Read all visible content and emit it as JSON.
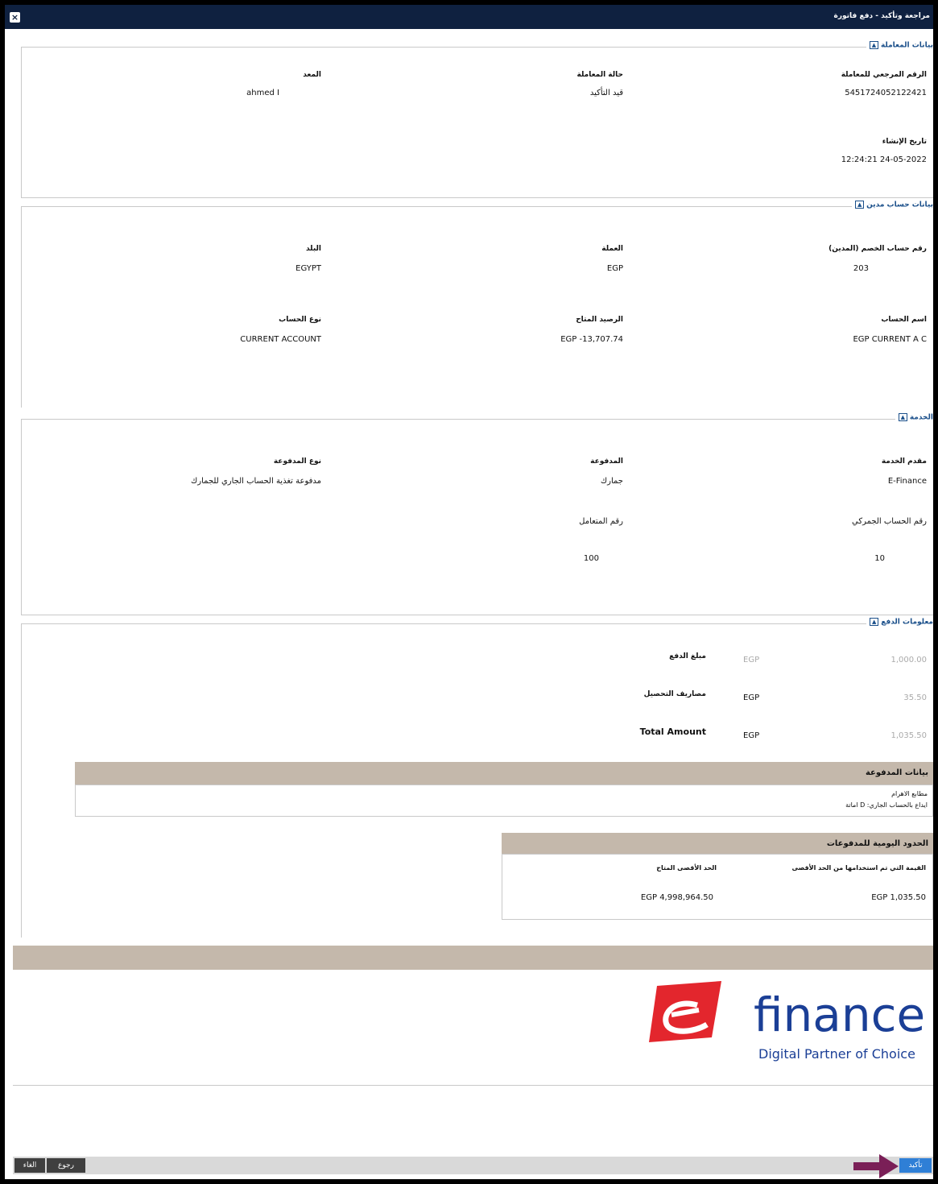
{
  "window": {
    "title": "مراجعة وتأكيد - دفع فاتورة"
  },
  "transaction": {
    "legend": "بيانات المعاملة",
    "ref_label": "الرقم المرجعي للمعاملة",
    "ref_value": "5451724052122421",
    "status_label": "حالة المعاملة",
    "status_value": "قيد التأكيد",
    "user_label": "المعد",
    "user_value": "ahmed I",
    "created_label": "تاريخ الإنشاء",
    "created_value": "12:24:21 24-05-2022"
  },
  "debit_account": {
    "legend": "بيانات حساب مدين",
    "account_no_label": "رقم حساب الخصم (المدين)",
    "account_no_value": "203",
    "currency_label": "العملة",
    "currency_value": "EGP",
    "country_label": "البلد",
    "country_value": "EGYPT",
    "account_name_label": "اسم الحساب",
    "account_name_value": "EGP CURRENT A C",
    "balance_label": "الرصيد المتاح",
    "balance_value": "EGP -13,707.74",
    "account_type_label": "نوع الحساب",
    "account_type_value": "CURRENT ACCOUNT"
  },
  "service": {
    "legend": "الخدمة",
    "provider_label": "مقدم الخدمة",
    "provider_value": "E-Finance",
    "payment_label": "المدفوعة",
    "payment_value": "جمارك",
    "payment_type_label": "نوع المدفوعة",
    "payment_type_value": "مدفوعة تغذية الحساب الجاري للجمارك",
    "customs_acc_label": "رقم الحساب الجمركي",
    "customs_acc_value": "10",
    "dealer_label": "رقم المتعامل",
    "dealer_value": "100"
  },
  "payment_info": {
    "legend": "معلومات الدفع",
    "rows": [
      {
        "label": "مبلغ الدفع",
        "currency": "EGP",
        "amount": "1,000.00"
      },
      {
        "label": "مصاريف التحصيل",
        "currency": "EGP",
        "amount": "35.50"
      },
      {
        "label": "Total Amount",
        "currency": "EGP",
        "amount": "1,035.50"
      }
    ],
    "bill_data_title": "بيانات المدفوعة",
    "bill_line_1": "مطابع الاهرام",
    "bill_line_2": "ايداع بالحساب الجاري: D اماتة",
    "daily_limits_title": "الحدود اليومية للمدفوعات",
    "used_label": "القيمة التي تم استخدامها من الحد الأقصى",
    "used_value": "EGP 1,035.50",
    "available_label": "الحد الأقصى المتاح",
    "available_value": "EGP 4,998,964.50"
  },
  "logo": {
    "brand": "finance",
    "tagline": "Digital Partner of Choice",
    "color_red": "#e3262d",
    "color_blue": "#1b3f96"
  },
  "buttons": {
    "confirm": "تأكيد",
    "back": "رجوع",
    "cancel": "الغاء"
  }
}
